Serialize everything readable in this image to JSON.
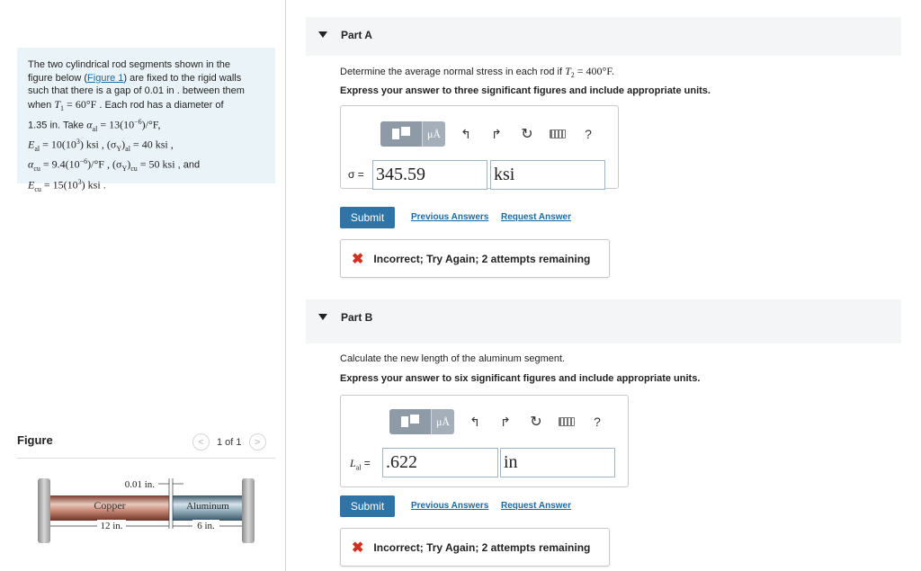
{
  "problem": {
    "line1": "The two cylindrical rod segments shown in the",
    "line2_pre": "figure below (",
    "figure_link": "Figure 1",
    "line2_post": ") are fixed to the rigid walls",
    "line3": "such that there is a gap of 0.01 in . between them",
    "line4_pre": "when ",
    "t1": "T",
    "t1_sub": "1",
    "t1_val": " = 60°F",
    "line4_post": " . Each rod has a diameter of",
    "line5_pre": "1.35 in. Take ",
    "alpha_al": "α",
    "alpha_al_sub": "al",
    "alpha_al_val": " = 13(10",
    "alpha_al_exp": "−6",
    "alpha_al_unit": ")/°F,",
    "e_al": "E",
    "e_al_sub": "al",
    "e_al_val": " = 10(10",
    "e_al_exp": "3",
    "e_al_unit": ") ksi",
    "sy_al_pre": " , (σ",
    "sy_sub_y": "Y",
    "sy_al_sub": "al",
    "sy_al_val": " = 40 ksi ,",
    "alpha_cu": "α",
    "alpha_cu_sub": "cu",
    "alpha_cu_val": " = 9.4(10",
    "alpha_cu_exp": "−6",
    "alpha_cu_unit": ")/°F",
    "sy_cu_pre": " , (σ",
    "sy_cu_sub": "cu",
    "sy_cu_val": " = 50 ksi",
    "and": " , and",
    "e_cu": "E",
    "e_cu_sub": "cu",
    "e_cu_val": " = 15(10",
    "e_cu_exp": "3",
    "e_cu_unit": ") ksi",
    "period": " ."
  },
  "figure": {
    "title": "Figure",
    "pager": "1 of 1",
    "prev": "<",
    "next": ">",
    "gap_label": "0.01 in.",
    "copper_label": "Copper",
    "aluminum_label": "Aluminum",
    "copper_len": "12 in.",
    "aluminum_len": "6 in."
  },
  "partA": {
    "label": "Part A",
    "question_pre": "Determine the average normal stress in each rod if ",
    "question_var": "T",
    "question_sub": "2",
    "question_val": " = 400°F.",
    "instruction": "Express your answer to three significant figures and include appropriate units.",
    "var_label": "σ =",
    "value": "345.59",
    "unit": "ksi",
    "submit": "Submit",
    "previous": "Previous Answers",
    "request": "Request Answer",
    "feedback": "Incorrect; Try Again; 2 attempts remaining"
  },
  "partB": {
    "label": "Part B",
    "question": "Calculate the new length of the aluminum segment.",
    "instruction": "Express your answer to six significant figures and include appropriate units.",
    "var_label": "L",
    "var_sub": "al",
    "var_eq": " =",
    "value": ".622",
    "unit": "in",
    "submit": "Submit",
    "previous": "Previous Answers",
    "request": "Request Answer",
    "feedback": "Incorrect; Try Again; 2 attempts remaining"
  },
  "toolbar": {
    "mu_label": "μÅ",
    "help": "?",
    "icons": [
      "template-icon",
      "units-icon",
      "undo-icon",
      "redo-icon",
      "reset-icon",
      "keyboard-icon",
      "help-icon"
    ]
  },
  "feedback_icon": "✖"
}
